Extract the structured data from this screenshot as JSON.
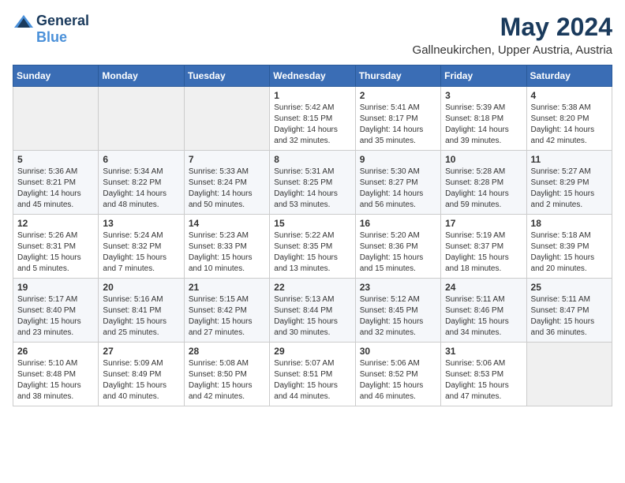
{
  "logo": {
    "general": "General",
    "blue": "Blue"
  },
  "title": "May 2024",
  "location": "Gallneukirchen, Upper Austria, Austria",
  "days_of_week": [
    "Sunday",
    "Monday",
    "Tuesday",
    "Wednesday",
    "Thursday",
    "Friday",
    "Saturday"
  ],
  "weeks": [
    [
      {
        "day": "",
        "content": ""
      },
      {
        "day": "",
        "content": ""
      },
      {
        "day": "",
        "content": ""
      },
      {
        "day": "1",
        "content": "Sunrise: 5:42 AM\nSunset: 8:15 PM\nDaylight: 14 hours\nand 32 minutes."
      },
      {
        "day": "2",
        "content": "Sunrise: 5:41 AM\nSunset: 8:17 PM\nDaylight: 14 hours\nand 35 minutes."
      },
      {
        "day": "3",
        "content": "Sunrise: 5:39 AM\nSunset: 8:18 PM\nDaylight: 14 hours\nand 39 minutes."
      },
      {
        "day": "4",
        "content": "Sunrise: 5:38 AM\nSunset: 8:20 PM\nDaylight: 14 hours\nand 42 minutes."
      }
    ],
    [
      {
        "day": "5",
        "content": "Sunrise: 5:36 AM\nSunset: 8:21 PM\nDaylight: 14 hours\nand 45 minutes."
      },
      {
        "day": "6",
        "content": "Sunrise: 5:34 AM\nSunset: 8:22 PM\nDaylight: 14 hours\nand 48 minutes."
      },
      {
        "day": "7",
        "content": "Sunrise: 5:33 AM\nSunset: 8:24 PM\nDaylight: 14 hours\nand 50 minutes."
      },
      {
        "day": "8",
        "content": "Sunrise: 5:31 AM\nSunset: 8:25 PM\nDaylight: 14 hours\nand 53 minutes."
      },
      {
        "day": "9",
        "content": "Sunrise: 5:30 AM\nSunset: 8:27 PM\nDaylight: 14 hours\nand 56 minutes."
      },
      {
        "day": "10",
        "content": "Sunrise: 5:28 AM\nSunset: 8:28 PM\nDaylight: 14 hours\nand 59 minutes."
      },
      {
        "day": "11",
        "content": "Sunrise: 5:27 AM\nSunset: 8:29 PM\nDaylight: 15 hours\nand 2 minutes."
      }
    ],
    [
      {
        "day": "12",
        "content": "Sunrise: 5:26 AM\nSunset: 8:31 PM\nDaylight: 15 hours\nand 5 minutes."
      },
      {
        "day": "13",
        "content": "Sunrise: 5:24 AM\nSunset: 8:32 PM\nDaylight: 15 hours\nand 7 minutes."
      },
      {
        "day": "14",
        "content": "Sunrise: 5:23 AM\nSunset: 8:33 PM\nDaylight: 15 hours\nand 10 minutes."
      },
      {
        "day": "15",
        "content": "Sunrise: 5:22 AM\nSunset: 8:35 PM\nDaylight: 15 hours\nand 13 minutes."
      },
      {
        "day": "16",
        "content": "Sunrise: 5:20 AM\nSunset: 8:36 PM\nDaylight: 15 hours\nand 15 minutes."
      },
      {
        "day": "17",
        "content": "Sunrise: 5:19 AM\nSunset: 8:37 PM\nDaylight: 15 hours\nand 18 minutes."
      },
      {
        "day": "18",
        "content": "Sunrise: 5:18 AM\nSunset: 8:39 PM\nDaylight: 15 hours\nand 20 minutes."
      }
    ],
    [
      {
        "day": "19",
        "content": "Sunrise: 5:17 AM\nSunset: 8:40 PM\nDaylight: 15 hours\nand 23 minutes."
      },
      {
        "day": "20",
        "content": "Sunrise: 5:16 AM\nSunset: 8:41 PM\nDaylight: 15 hours\nand 25 minutes."
      },
      {
        "day": "21",
        "content": "Sunrise: 5:15 AM\nSunset: 8:42 PM\nDaylight: 15 hours\nand 27 minutes."
      },
      {
        "day": "22",
        "content": "Sunrise: 5:13 AM\nSunset: 8:44 PM\nDaylight: 15 hours\nand 30 minutes."
      },
      {
        "day": "23",
        "content": "Sunrise: 5:12 AM\nSunset: 8:45 PM\nDaylight: 15 hours\nand 32 minutes."
      },
      {
        "day": "24",
        "content": "Sunrise: 5:11 AM\nSunset: 8:46 PM\nDaylight: 15 hours\nand 34 minutes."
      },
      {
        "day": "25",
        "content": "Sunrise: 5:11 AM\nSunset: 8:47 PM\nDaylight: 15 hours\nand 36 minutes."
      }
    ],
    [
      {
        "day": "26",
        "content": "Sunrise: 5:10 AM\nSunset: 8:48 PM\nDaylight: 15 hours\nand 38 minutes."
      },
      {
        "day": "27",
        "content": "Sunrise: 5:09 AM\nSunset: 8:49 PM\nDaylight: 15 hours\nand 40 minutes."
      },
      {
        "day": "28",
        "content": "Sunrise: 5:08 AM\nSunset: 8:50 PM\nDaylight: 15 hours\nand 42 minutes."
      },
      {
        "day": "29",
        "content": "Sunrise: 5:07 AM\nSunset: 8:51 PM\nDaylight: 15 hours\nand 44 minutes."
      },
      {
        "day": "30",
        "content": "Sunrise: 5:06 AM\nSunset: 8:52 PM\nDaylight: 15 hours\nand 46 minutes."
      },
      {
        "day": "31",
        "content": "Sunrise: 5:06 AM\nSunset: 8:53 PM\nDaylight: 15 hours\nand 47 minutes."
      },
      {
        "day": "",
        "content": ""
      }
    ]
  ]
}
